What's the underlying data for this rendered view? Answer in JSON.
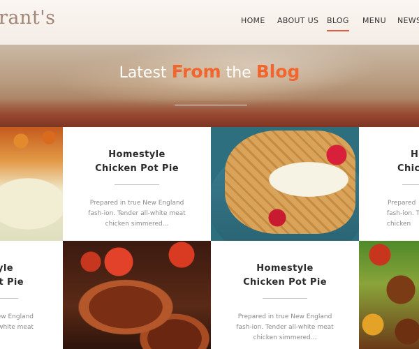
{
  "brand": {
    "logo_text": "rant's"
  },
  "nav": {
    "items": [
      {
        "label": "HOME"
      },
      {
        "label": "ABOUT US"
      },
      {
        "label": "BLOG"
      },
      {
        "label": "MENU"
      },
      {
        "label": "NEWS"
      }
    ],
    "active": "BLOG",
    "accent_color": "#e55a3c"
  },
  "hero": {
    "title_part1": "Latest",
    "title_accent1": "From",
    "title_part2": "the",
    "title_accent2": "Blog",
    "accent_color": "#f0662e"
  },
  "posts": [
    {
      "title_line1": "Homestyle",
      "title_line2": "Chicken Pot Pie",
      "excerpt_line1": "Prepared in true New England",
      "excerpt_line2": "fash-ion. Tender all-white meat",
      "excerpt_line3": "chicken simmered..."
    },
    {
      "title_line1": "Ho",
      "title_line2": "Chick",
      "excerpt_line1": "Prepared",
      "excerpt_line2": "fash-ion. T",
      "excerpt_line3": "chicken"
    },
    {
      "title_line1": "style",
      "title_line2": "ot Pie",
      "excerpt_line1": "ew England",
      "excerpt_line2": "-white meat",
      "excerpt_line3": ""
    },
    {
      "title_line1": "Homestyle",
      "title_line2": "Chicken Pot Pie",
      "excerpt_line1": "Prepared in true New England",
      "excerpt_line2": "fash-ion. Tender all-white meat",
      "excerpt_line3": "chicken simmered..."
    }
  ],
  "images": [
    {
      "icon": "salad-photo"
    },
    {
      "icon": "waffle-strawberry-photo"
    },
    {
      "icon": "steak-tomato-photo"
    },
    {
      "icon": "grilled-skewer-photo"
    }
  ]
}
